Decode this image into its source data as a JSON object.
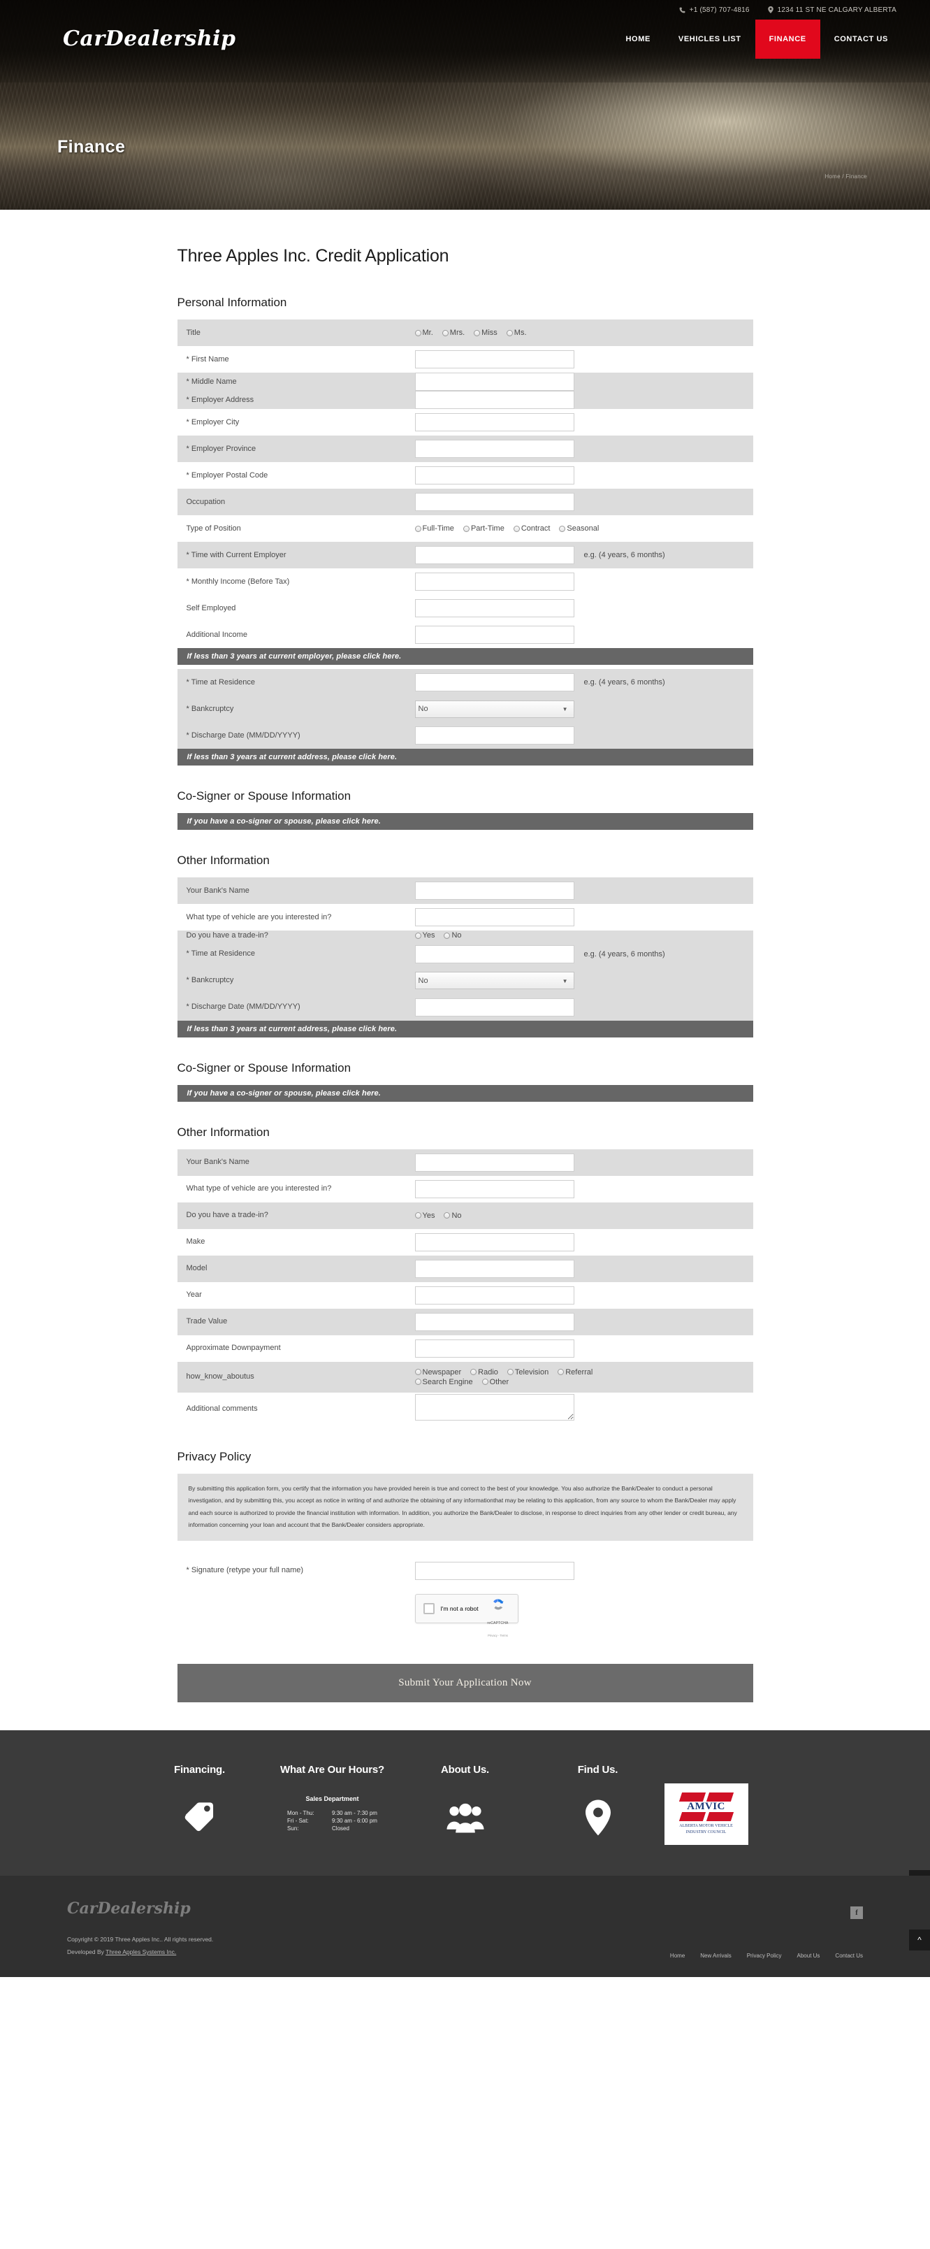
{
  "header": {
    "logo": "CarDealership",
    "phone": "+1 (587) 707-4816",
    "address": "1234 11 ST NE CALGARY ALBERTA",
    "nav": [
      {
        "label": "HOME",
        "active": false
      },
      {
        "label": "VEHICLES LIST",
        "active": false
      },
      {
        "label": "FINANCE",
        "active": true
      },
      {
        "label": "CONTACT US",
        "active": false
      }
    ],
    "page_title": "Finance",
    "breadcrumb": "Home / Finance",
    "accent_color": "#e1081c"
  },
  "form": {
    "title": "Three Apples Inc. Credit Application",
    "sections": {
      "personal": "Personal Information",
      "cosigner": "Co-Signer or Spouse Information",
      "other": "Other Information",
      "privacy": "Privacy Policy"
    },
    "labels": {
      "title": "Title",
      "first_name": "* First Name",
      "middle_name": "* Middle Name",
      "employer_address": "* Employer Address",
      "employer_city": "* Employer City",
      "employer_province": "* Employer Province",
      "employer_postal": "* Employer Postal Code",
      "occupation": "Occupation",
      "type_of_position": "Type of Position",
      "time_employer": "* Time with Current Employer",
      "monthly_income": "* Monthly Income (Before Tax)",
      "self_employed": "Self Employed",
      "additional_income": "Additional Income",
      "time_residence": "* Time at Residence",
      "bankruptcy": "* Bankcruptcy",
      "discharge_date": "* Discharge Date (MM/DD/YYYY)",
      "bank_name": "Your Bank's Name",
      "vehicle_type": "What type of vehicle are you interested in?",
      "trade_in": "Do you have a trade-in?",
      "make": "Make",
      "model": "Model",
      "year": "Year",
      "trade_value": "Trade Value",
      "downpayment": "Approximate Downpayment",
      "how_know": "how_know_aboutus",
      "comments": "Additional comments",
      "signature": "* Signature (retype your full name)"
    },
    "hints": {
      "duration_example": "e.g. (4 years, 6 months)"
    },
    "options": {
      "titles": [
        "Mr.",
        "Mrs.",
        "Miss",
        "Ms."
      ],
      "position_types": [
        "Full-Time",
        "Part-Time",
        "Contract",
        "Seasonal"
      ],
      "yes_no": [
        "Yes",
        "No"
      ],
      "how_know": [
        "Newspaper",
        "Radio",
        "Television",
        "Referral",
        "Search Engine",
        "Other"
      ],
      "bankruptcy_selected": "No"
    },
    "banners": {
      "employer_3yr": "If less than 3 years at current employer, please click here.",
      "address_3yr": "If less than 3 years at current address, please click here.",
      "cosigner": "If you have a co-signer or spouse, please click here."
    },
    "privacy_text": "By submitting this application form, you certify that the information you have provided herein is true and correct to the best of your knowledge. You also authorize the Bank/Dealer to conduct a personal investigation, and by submitting this, you accept as notice in writing of and authorize the obtaining of any informationthat may be relating to this application, from any source to whom the Bank/Dealer may apply and each source is authorized to provide the financial institution with information. In addition, you authorize the Bank/Dealer to disclose, in response to direct inquiries from any other lender or credit bureau, any information concerning your loan and account that the Bank/Dealer considers appropriate.",
    "recaptcha": {
      "text": "I'm not a robot",
      "brand": "reCAPTCHA",
      "legal": "Privacy - Terms"
    },
    "submit_label": "Submit Your Application Now"
  },
  "footer": {
    "columns": {
      "financing": "Financing.",
      "hours": "What Are Our Hours?",
      "about": "About Us.",
      "find": "Find Us."
    },
    "hours": {
      "department": "Sales Department",
      "rows": [
        {
          "day": "Mon - Thu:",
          "time": "9:30 am - 7:30 pm"
        },
        {
          "day": "Fri - Sat:",
          "time": "9:30 am - 6:00 pm"
        },
        {
          "day": "Sun:",
          "time": "Closed"
        }
      ]
    },
    "amvic": {
      "word": "AMVIC",
      "line1": "ALBERTA MOTOR VEHICLE",
      "line2": "INDUSTRY COUNCIL"
    },
    "bottom": {
      "logo": "CarDealership",
      "copyright": "Copyright © 2019 Three Apples Inc.. All rights reserved.",
      "developed_prefix": "Developed By ",
      "developed_link": "Three Apples Systems Inc.",
      "links": [
        "Home",
        "New Arrivals",
        "Privacy Policy",
        "About Us",
        "Contact Us"
      ],
      "social": "f",
      "to_top": "^"
    }
  }
}
